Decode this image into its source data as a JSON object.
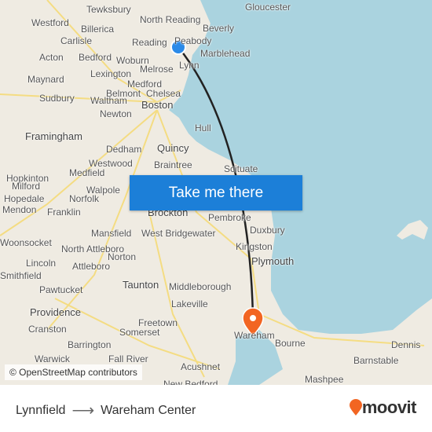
{
  "map": {
    "labels": [
      "Gloucester",
      "Tewksbury",
      "North Reading",
      "Westford",
      "Billerica",
      "Beverly",
      "Carlisle",
      "Reading",
      "Peabody",
      "Marblehead",
      "Acton",
      "Bedford",
      "Woburn",
      "Lynn",
      "Melrose",
      "Maynard",
      "Lexington",
      "Medford",
      "Belmont",
      "Sudbury",
      "Waltham",
      "Chelsea",
      "Boston",
      "Newton",
      "Hull",
      "Framingham",
      "Dedham",
      "Quincy",
      "Hopkinton",
      "Westwood",
      "Braintree",
      "Scituate",
      "Medfield",
      "Milford",
      "Walpole",
      "Norfolk",
      "Hopedale",
      "Mendon",
      "Franklin",
      "Brockton",
      "Pembroke",
      "Duxbury",
      "Mansfield",
      "West Bridgewater",
      "Kingston",
      "Woonsocket",
      "North Attleboro",
      "Norton",
      "Plymouth",
      "Lincoln",
      "Attleboro",
      "Smithfield",
      "Taunton",
      "Middleborough",
      "Pawtucket",
      "Lakeville",
      "Providence",
      "Freetown",
      "Cranston",
      "Somerset",
      "Barrington",
      "Wareham",
      "Bourne",
      "Dennis",
      "Warwick",
      "Fall River",
      "Barnstable",
      "Acushnet",
      "New Bedford",
      "Mashpee"
    ],
    "attribution": "© OpenStreetMap contributors",
    "cta_label": "Take me there",
    "origin_color": "#2b8ae8",
    "destination_color": "#f26522",
    "route_color": "#222222"
  },
  "footer": {
    "from": "Lynnfield",
    "to": "Wareham Center",
    "arrow_icon": "arrow-right-icon",
    "brand": "moovit",
    "brand_color": "#f26522"
  }
}
